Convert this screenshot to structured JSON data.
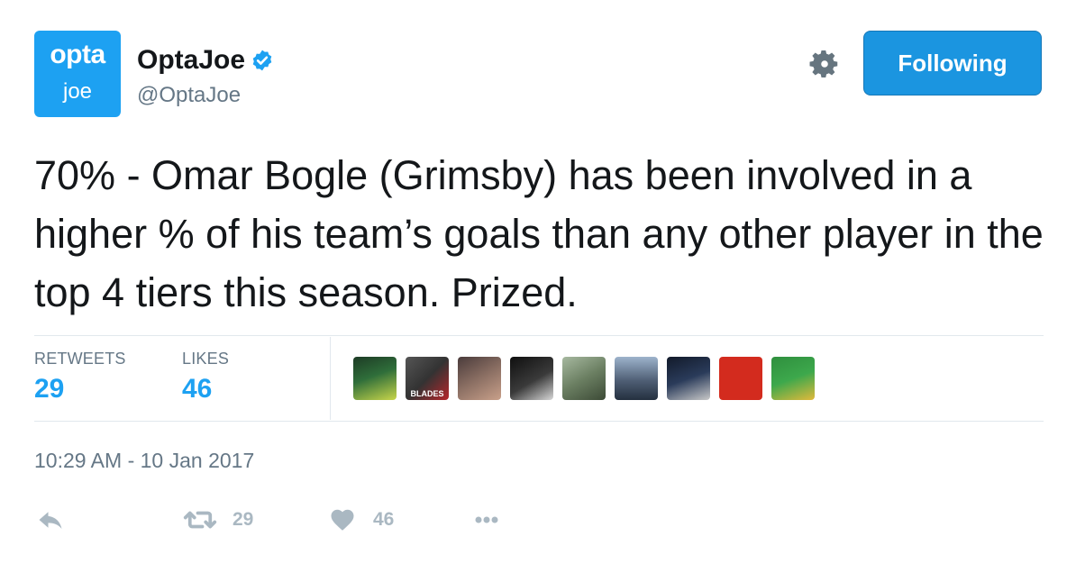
{
  "profile": {
    "avatar_line1": "opta",
    "avatar_line2": "joe",
    "display_name": "OptaJoe",
    "handle": "@OptaJoe"
  },
  "follow_button_label": "Following",
  "tweet": {
    "text": "70% - Omar Bogle (Grimsby) has been involved in a higher % of his team’s goals than any other player in the top 4 tiers this season. Prized."
  },
  "stats": {
    "retweets_label": "RETWEETS",
    "retweets_value": "29",
    "likes_label": "LIKES",
    "likes_value": "46"
  },
  "likers": [
    {
      "caption": ""
    },
    {
      "caption": "BLADES"
    },
    {
      "caption": ""
    },
    {
      "caption": ""
    },
    {
      "caption": ""
    },
    {
      "caption": ""
    },
    {
      "caption": ""
    },
    {
      "caption": ""
    },
    {
      "caption": ""
    }
  ],
  "timestamp": "10:29 AM - 10 Jan 2017",
  "actions": {
    "retweet_count": "29",
    "like_count": "46"
  },
  "colors": {
    "brand_blue": "#1da1f2",
    "button_blue": "#1b95e0",
    "muted_gray": "#657786",
    "icon_gray": "#aab8c2"
  }
}
